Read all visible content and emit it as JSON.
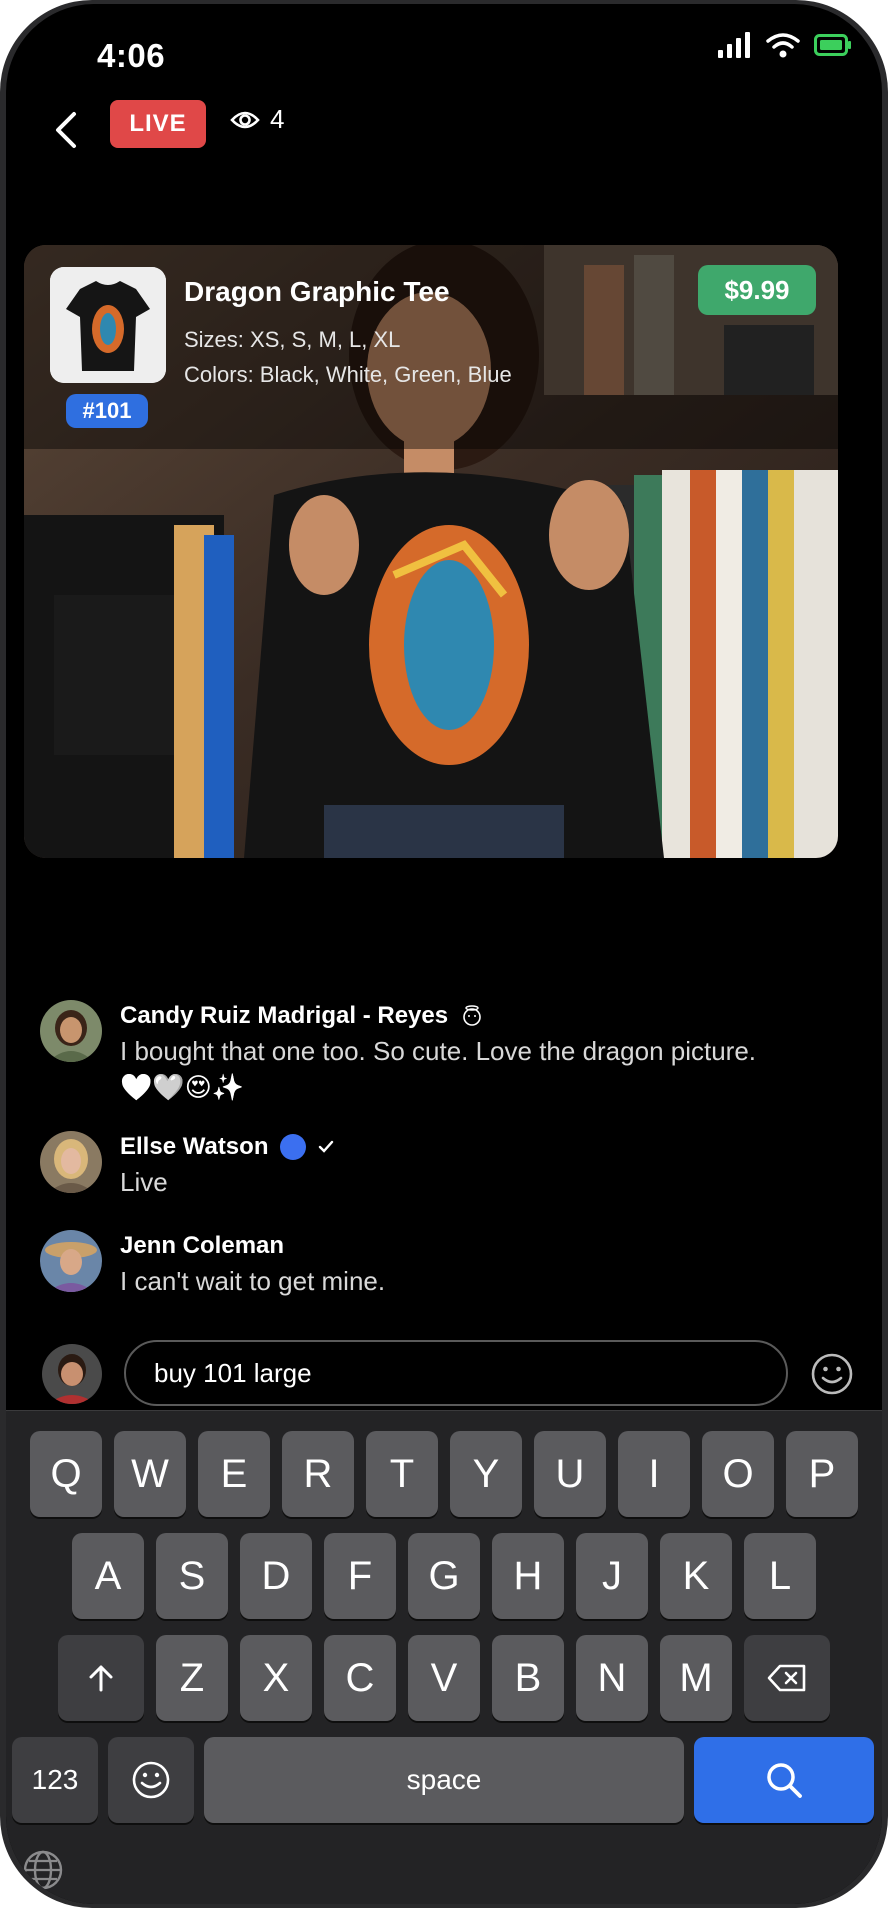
{
  "status_bar": {
    "time": "4:06"
  },
  "header": {
    "live_label": "LIVE",
    "viewer_count": "4"
  },
  "product": {
    "name": "Dragon Graphic Tee",
    "sizes": "Sizes: XS, S, M, L, XL",
    "colors": "Colors: Black, White, Green, Blue",
    "price": "$9.99",
    "item_number": "#101"
  },
  "comments": [
    {
      "name": "Candy Ruiz Madrigal - Reyes",
      "text": "I bought that one too. So cute. Love the dragon picture.",
      "emoji_line": "💛❤️😍✨"
    },
    {
      "name": "Ellse Watson",
      "text": "Live"
    },
    {
      "name": "Jenn Coleman",
      "text": "I can't wait to get mine."
    }
  ],
  "chat_input": {
    "value": "buy 101 large"
  },
  "keyboard": {
    "row1": [
      "Q",
      "W",
      "E",
      "R",
      "T",
      "Y",
      "U",
      "I",
      "O",
      "P"
    ],
    "row2": [
      "A",
      "S",
      "D",
      "F",
      "G",
      "H",
      "J",
      "K",
      "L"
    ],
    "row3": [
      "Z",
      "X",
      "C",
      "V",
      "B",
      "N",
      "M"
    ],
    "numbers_label": "123",
    "space_label": "space"
  },
  "colors": {
    "live_red": "#e04848",
    "price_green": "#3fa86c",
    "accent_blue": "#2f6fe8"
  }
}
